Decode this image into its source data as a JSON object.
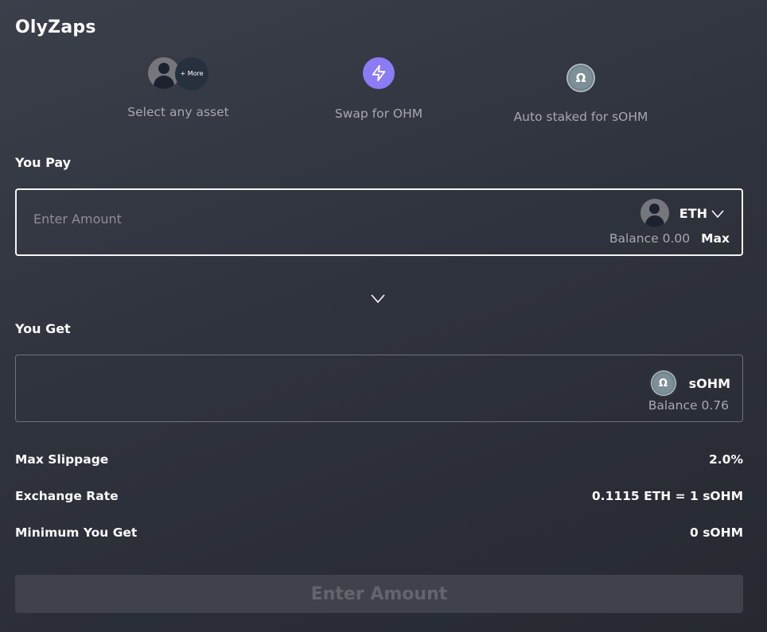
{
  "app": {
    "title": "OlyZaps"
  },
  "steps": [
    {
      "label": "Select any asset",
      "badge": "+ More"
    },
    {
      "label": "Swap for OHM"
    },
    {
      "label": "Auto staked for sOHM"
    }
  ],
  "pay": {
    "label": "You Pay",
    "placeholder": "Enter Amount",
    "token": "ETH",
    "balance": "Balance 0.00",
    "max_label": "Max"
  },
  "get": {
    "label": "You Get",
    "token": "sOHM",
    "balance": "Balance 0.76"
  },
  "details": [
    {
      "label": "Max Slippage",
      "value": "2.0%"
    },
    {
      "label": "Exchange Rate",
      "value": "0.1115 ETH = 1 sOHM"
    },
    {
      "label": "Minimum You Get",
      "value": "0 sOHM"
    }
  ],
  "submit_label": "Enter Amount",
  "colors": {
    "zap_purple": "#8b7bf5",
    "background": "#2f333d"
  },
  "icons": {
    "ohm_symbol": "Ω"
  }
}
